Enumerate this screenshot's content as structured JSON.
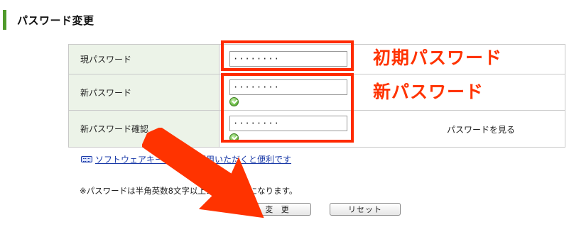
{
  "page": {
    "title": "パスワード変更"
  },
  "form": {
    "rows": [
      {
        "label": "現パスワード",
        "value": "········"
      },
      {
        "label": "新パスワード",
        "value": "········"
      },
      {
        "label": "新パスワード確認",
        "value": "········"
      }
    ],
    "show_password_label": "パスワードを見る"
  },
  "keyboard_link": {
    "text": "ソフトウェアキーボードを利用いただくと便利です"
  },
  "note": "※パスワードは半角英数8文字以上16文字以下になります。",
  "buttons": {
    "change": "変 更",
    "reset": "リセット"
  },
  "annotations": {
    "current_label": "初期パスワード",
    "new_label": "新パスワード",
    "color": "#ff2a00"
  }
}
